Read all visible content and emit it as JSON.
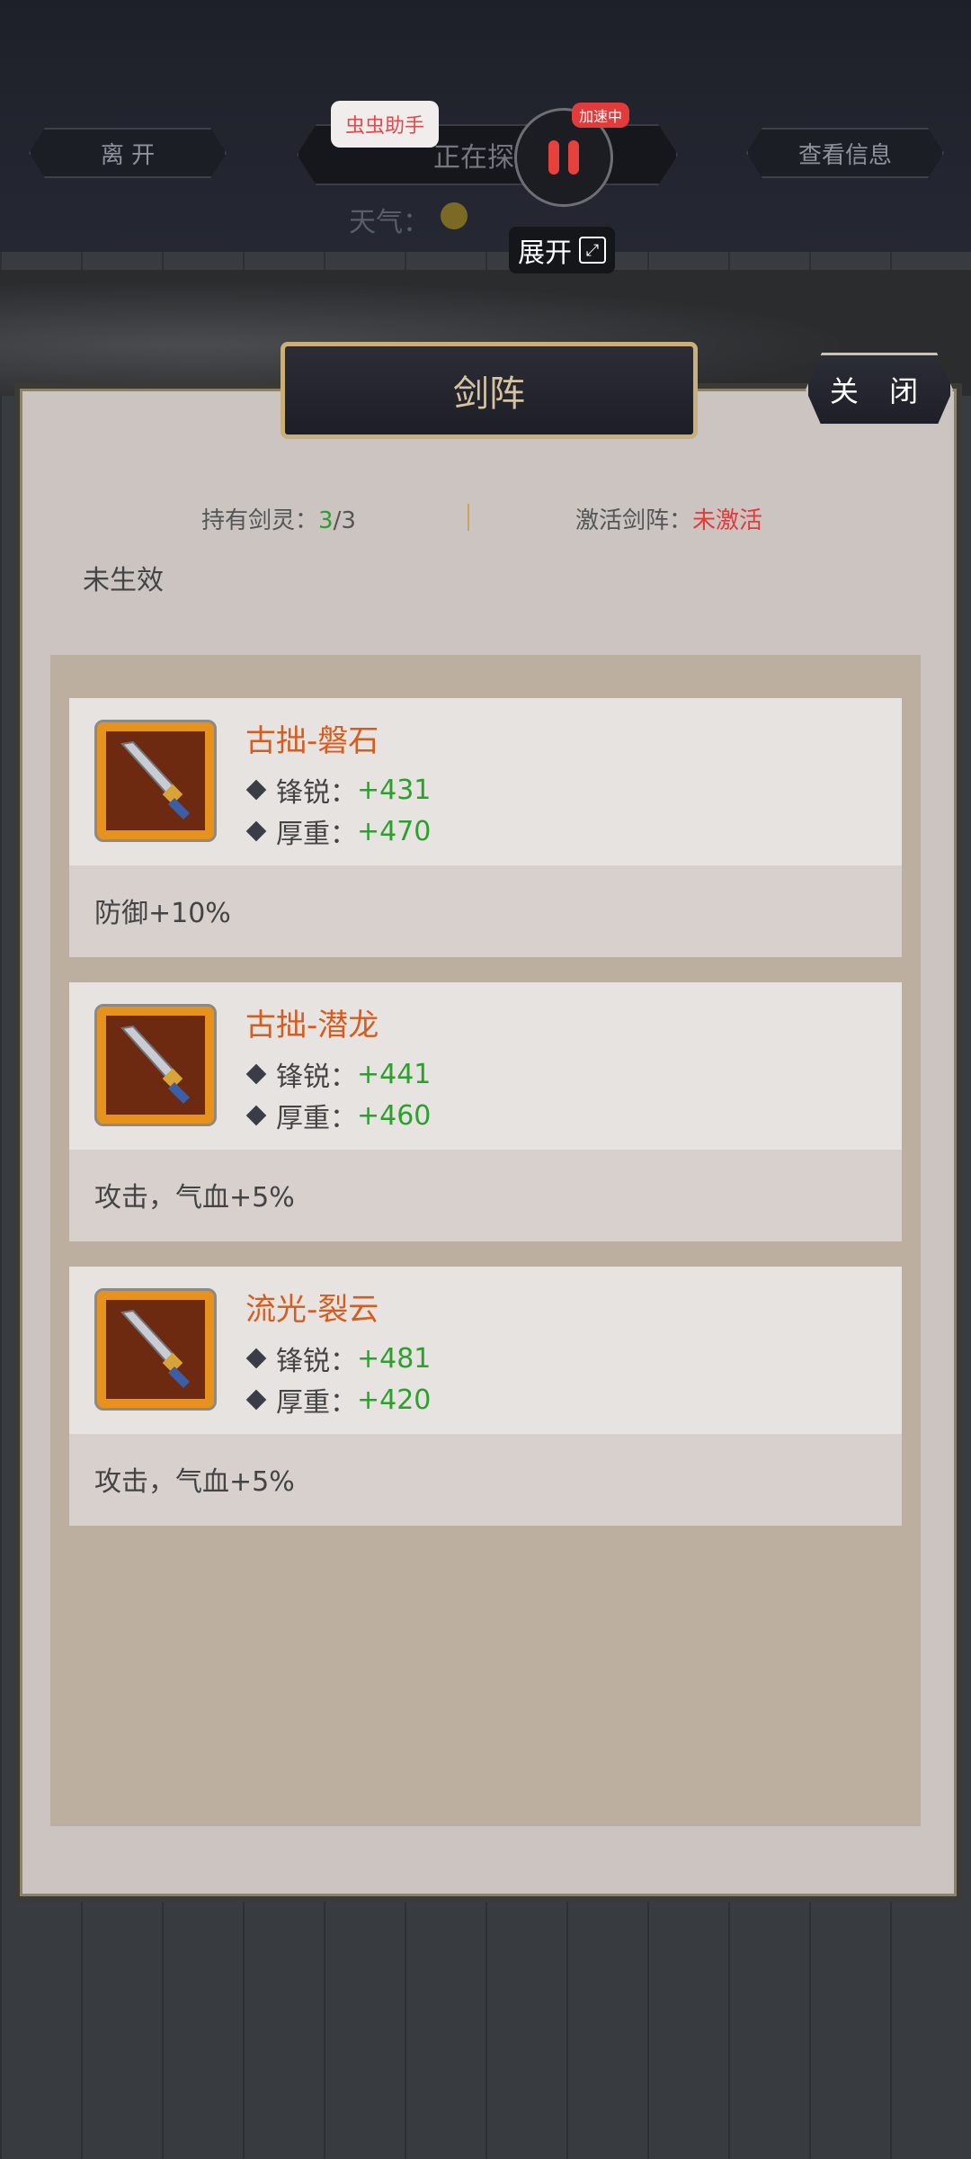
{
  "topbar": {
    "leave_label": "离 开",
    "view_info_label": "查看信息",
    "exploring_title": "正在探索",
    "weather_label": "天气："
  },
  "overlay": {
    "assistant_label": "虫虫助手",
    "speed_badge": "加速中",
    "expand_label": "展开"
  },
  "panel": {
    "title": "剑阵",
    "close_label": "关 闭",
    "held_label": "持有剑灵：",
    "held_count": "3",
    "held_total": "/3",
    "activate_label": "激活剑阵：",
    "activate_status": "未激活",
    "effect_status": "未生效"
  },
  "colors": {
    "accent_orange": "#d45d1f",
    "stat_green": "#2ca02c",
    "status_red": "#e23b3b",
    "panel_bg": "#cbc4c1"
  },
  "swords": [
    {
      "name": "古拙-磐石",
      "sharp_label": "锋锐：",
      "sharp_value": "+431",
      "heavy_label": "厚重：",
      "heavy_value": "+470",
      "effect": "防御+10%"
    },
    {
      "name": "古拙-潜龙",
      "sharp_label": "锋锐：",
      "sharp_value": "+441",
      "heavy_label": "厚重：",
      "heavy_value": "+460",
      "effect": "攻击，气血+5%"
    },
    {
      "name": "流光-裂云",
      "sharp_label": "锋锐：",
      "sharp_value": "+481",
      "heavy_label": "厚重：",
      "heavy_value": "+420",
      "effect": "攻击，气血+5%"
    }
  ]
}
